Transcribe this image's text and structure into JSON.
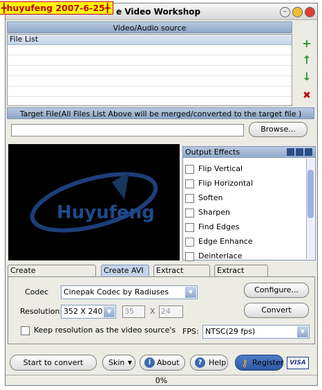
{
  "watermark": "╋huyufeng   2007-6-25╋",
  "window": {
    "title": "Video Workshop",
    "title_prefix_visible": "e",
    "minimize": "–",
    "maximize": "",
    "close": ""
  },
  "source": {
    "header": "Video/Audio source",
    "file_list_header": "File List",
    "buttons": {
      "add": "+",
      "up": "↑",
      "down": "↓",
      "remove": "✖"
    }
  },
  "target": {
    "header": "Target File(All Files List Above will be merged/converted to the target file )",
    "path_value": "",
    "browse_label": "Browse..."
  },
  "preview": {
    "logo_text": "Huyufeng"
  },
  "effects": {
    "header": "Output Effects",
    "items": [
      "Flip Vertical",
      "Flip Horizontal",
      "Soften",
      "Sharpen",
      "Find Edges",
      "Edge Enhance",
      "Deinterlace"
    ]
  },
  "tabs": [
    "Create VCD/SVCD/DVD",
    "Create AVI",
    "Extract Audio",
    "Extract Image"
  ],
  "avi": {
    "codec_label": "Codec",
    "codec_value": "Cinepak Codec by Radiuses",
    "configure_label": "Configure...",
    "resolution_label": "Resolution:",
    "resolution_value": "352 X 240",
    "width_value": "35",
    "x_sep": "X",
    "height_value": "24",
    "convert_label": "Convert",
    "keep_res_label": "Keep resolution as the video source's",
    "fps_label": "FPS:",
    "fps_value": "NTSC(29 fps)"
  },
  "bottom": {
    "start_label": "Start to convert",
    "skin_label": "Skin",
    "about_label": "About",
    "help_label": "Help",
    "register_label": "Register",
    "visa_label": "VISA"
  },
  "status": {
    "progress_text": "0%",
    "progress": 0
  }
}
